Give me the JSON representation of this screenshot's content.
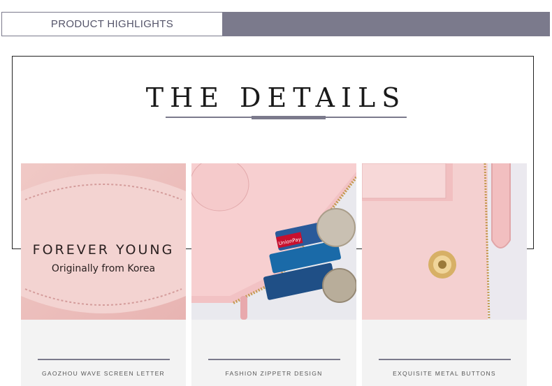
{
  "header": {
    "highlights_label": "PRODUCT HIGHLIGHTS"
  },
  "section": {
    "title": "THE DETAILS"
  },
  "details": [
    {
      "caption": "GAOZHOU WAVE SCREEN LETTER",
      "emboss_line1": "FOREVER YOUNG",
      "emboss_line2": "Originally from Korea"
    },
    {
      "caption": "FASHION ZIPPETR DESIGN",
      "card_brand": "UnionPay"
    },
    {
      "caption": "EXQUISITE METAL BUTTONS"
    }
  ],
  "colors": {
    "accent": "#7b7a8c",
    "wallet_pink": "#f2c4c4",
    "caption_bg": "#f3f3f3"
  }
}
